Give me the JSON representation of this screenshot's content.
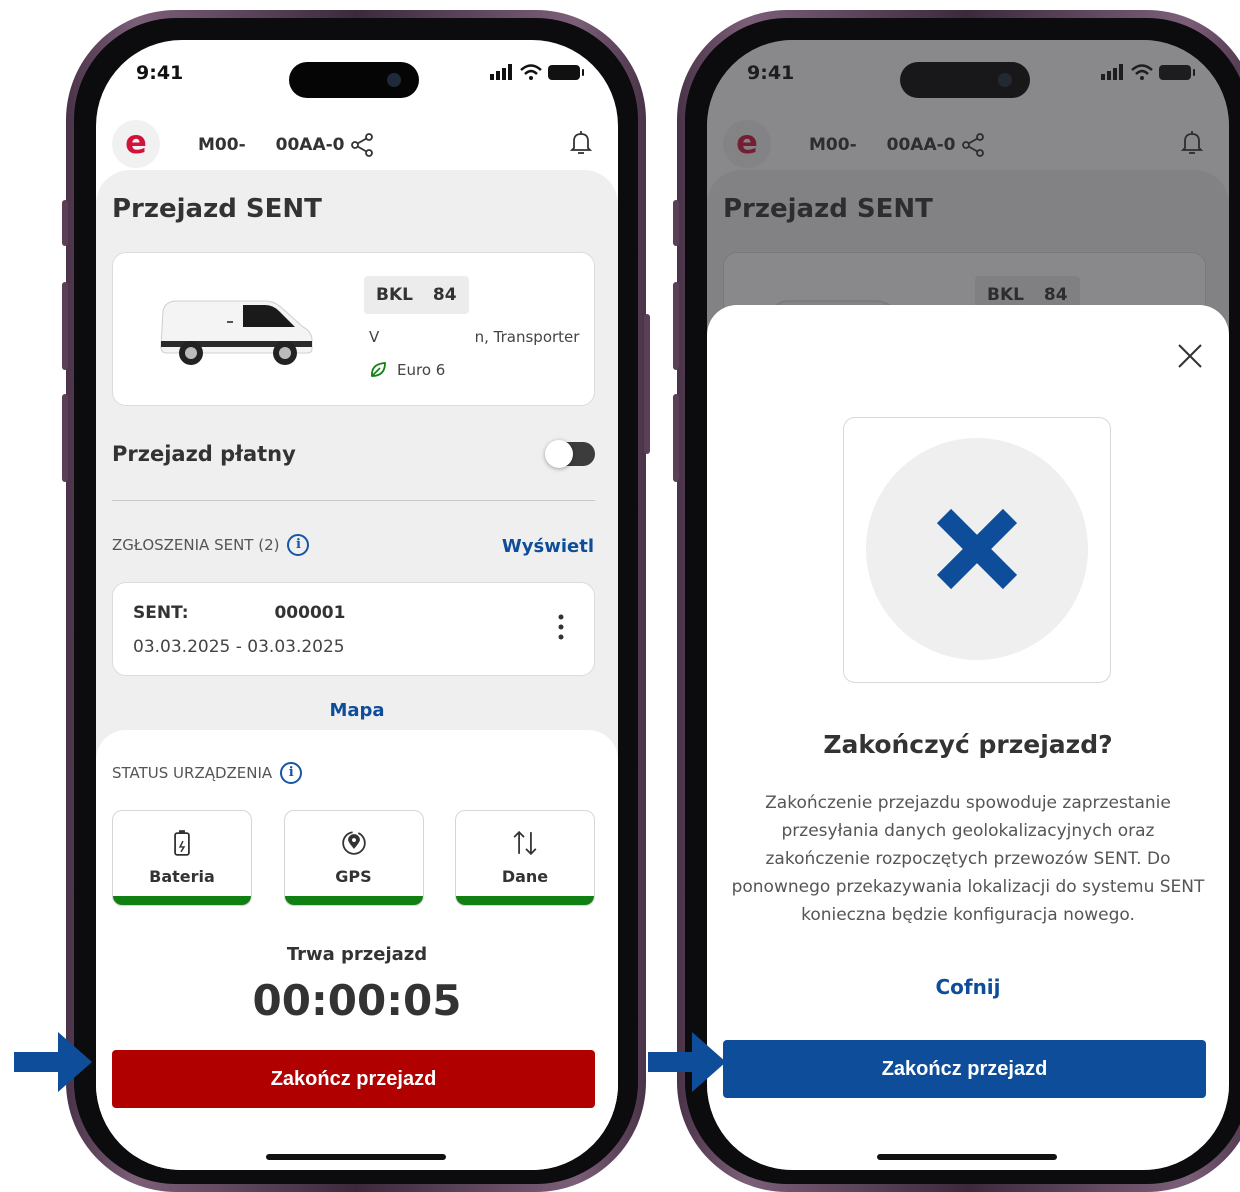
{
  "colors": {
    "accent_blue": "#0d4d9a",
    "danger_red": "#b00000",
    "status_green": "#118012",
    "brand_red": "#d3123a"
  },
  "status_bar": {
    "time": "9:41"
  },
  "header": {
    "logo_glyph": "e",
    "plate_part1": "M00-",
    "plate_part2": "00AA-0",
    "icons": [
      "share-icon",
      "bell-icon"
    ]
  },
  "page": {
    "title": "Przejazd SENT"
  },
  "vehicle": {
    "plate": "BKL 84",
    "model": "V                    n, Transporter",
    "emission": "Euro 6"
  },
  "paid_ride": {
    "label": "Przejazd płatny",
    "enabled": false
  },
  "sent_section": {
    "label": "ZGŁOSZENIA SENT (2)",
    "show_link": "Wyświetl",
    "item": {
      "id": "SENT: 000001",
      "dates": "03.03.2025 - 03.03.2025"
    },
    "map_link": "Mapa"
  },
  "device_status": {
    "label": "STATUS URZĄDZENIA",
    "tiles": [
      {
        "label": "Bateria",
        "icon": "battery-icon"
      },
      {
        "label": "GPS",
        "icon": "location-icon"
      },
      {
        "label": "Dane",
        "icon": "data-transfer-icon"
      }
    ]
  },
  "ride": {
    "label": "Trwa przejazd",
    "timer": "00:00:05",
    "end_button": "Zakończ przejazd"
  },
  "modal": {
    "title": "Zakończyć przejazd?",
    "text": "Zakończenie przejazdu spowoduje zaprzestanie przesyłania danych geolokalizacyjnych oraz zakończenie rozpoczętych przewozów SENT. Do ponownego przekazywania lokalizacji do systemu SENT konieczna będzie konfiguracja nowego.",
    "cancel": "Cofnij",
    "confirm": "Zakończ przejazd"
  }
}
